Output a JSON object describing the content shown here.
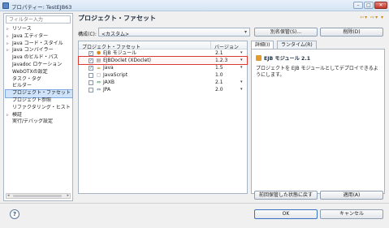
{
  "window": {
    "title": "プロパティー: TestEJB63"
  },
  "nav": {
    "filter_placeholder": "フィルター入力",
    "items": [
      {
        "label": "リソース",
        "expandable": true
      },
      {
        "label": "Java エディター",
        "expandable": true
      },
      {
        "label": "Java コード・スタイル",
        "expandable": true
      },
      {
        "label": "Java コンパイラー",
        "expandable": true
      },
      {
        "label": "Java のビルド・パス",
        "expandable": false
      },
      {
        "label": "Javadoc ロケーション",
        "expandable": false
      },
      {
        "label": "WebOTXの設定",
        "expandable": false
      },
      {
        "label": "タスク・タグ",
        "expandable": false
      },
      {
        "label": "ビルダー",
        "expandable": false
      },
      {
        "label": "プロジェクト・ファセット",
        "expandable": false,
        "selected": true
      },
      {
        "label": "プロジェクト参照",
        "expandable": false
      },
      {
        "label": "リファクタリング・ヒスト",
        "expandable": false
      },
      {
        "label": "検証",
        "expandable": true
      },
      {
        "label": "実行/デバッグ設定",
        "expandable": false
      }
    ]
  },
  "page": {
    "title": "プロジェクト・ファセット"
  },
  "config": {
    "label": "構成(C):",
    "value": "<カスタム>"
  },
  "buttons": {
    "save_as": "別名保管(S)...",
    "delete": "削除(D)",
    "revert": "前回保管した状態に戻す",
    "apply": "適用(A)",
    "ok": "OK",
    "cancel": "キャンセル",
    "help": "?"
  },
  "facets": {
    "col_name": "プロジェクト・ファセット",
    "col_version": "バージョン",
    "rows": [
      {
        "checked": true,
        "icon": "ejb-icon",
        "name": "EJB モジュール",
        "version": "2.1",
        "dropdown": true,
        "selected": false
      },
      {
        "checked": true,
        "icon": "doclet-icon",
        "name": "EJBDoclet (XDoclet)",
        "version": "1.2.3",
        "dropdown": true,
        "selected": true
      },
      {
        "checked": true,
        "icon": "java-icon",
        "name": "Java",
        "version": "1.5",
        "dropdown": true,
        "selected": false
      },
      {
        "checked": false,
        "icon": "javascript-icon",
        "name": "JavaScript",
        "version": "1.0",
        "dropdown": false,
        "selected": false
      },
      {
        "checked": false,
        "icon": "jaxb-icon",
        "name": "JAXB",
        "version": "2.1",
        "dropdown": true,
        "selected": false
      },
      {
        "checked": false,
        "icon": "jpa-icon",
        "name": "JPA",
        "version": "2.0",
        "dropdown": true,
        "selected": false
      }
    ]
  },
  "tabs": [
    {
      "label": "詳細(I)",
      "active": true
    },
    {
      "label": "ランタイム(R)",
      "active": false
    }
  ],
  "detail": {
    "title": "EJB モジュール 2.1",
    "text": "プロジェクトを EJB モジュールとしてデプロイできるようにします。"
  },
  "colors": {
    "accent": "#3b73c4",
    "selection_outline": "#d83b34"
  }
}
